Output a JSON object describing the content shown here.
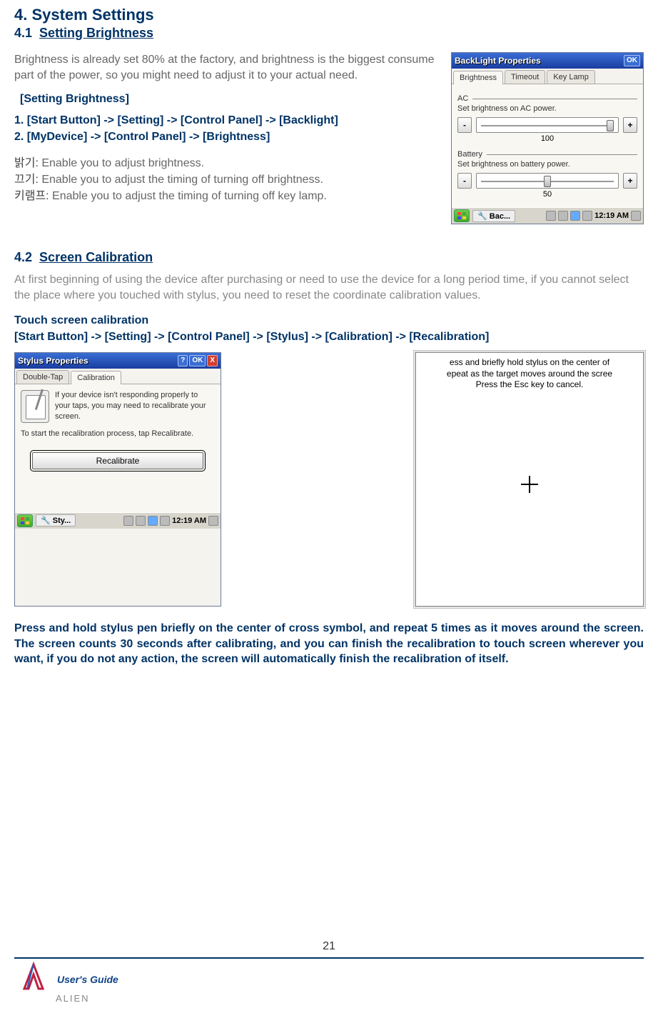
{
  "heading": "4. System Settings",
  "s41": {
    "num": "4.1",
    "title": "Setting Brightness",
    "intro": "Brightness is already set 80% at the factory, and brightness is the biggest consume part of the power, so you might need to adjust it to your actual need.",
    "subhead": "[Setting Brightness]",
    "step1": "1. [Start Button] -> [Setting] -> [Control Panel] -> [Backlight]",
    "step2": "2. [MyDevice] -> [Control Panel] -> [Brightness]",
    "def1_k": "밝기:",
    "def1_v": " Enable you to adjust brightness.",
    "def2_k": "끄기:",
    "def2_v": " Enable you to adjust the timing of turning off brightness.",
    "def3_k": "키램프:",
    "def3_v": " Enable you to adjust the timing of turning off key lamp."
  },
  "dlg_backlight": {
    "title": "BackLight Properties",
    "ok": "OK",
    "tabs": [
      "Brightness",
      "Timeout",
      "Key Lamp"
    ],
    "ac_label": "AC",
    "ac_hint": "Set brightness on AC power.",
    "ac_value": "100",
    "bat_label": "Battery",
    "bat_hint": "Set brightness on battery power.",
    "bat_value": "50",
    "minus": "-",
    "plus": "+",
    "task_app": "Bac...",
    "clock": "12:19 AM"
  },
  "s42": {
    "num": "4.2",
    "title": "Screen Calibration",
    "intro": "At first beginning of using the device after purchasing or need to use the device for a long period time, if you cannot select the place where you touched with stylus, you need to reset the coordinate calibration values.",
    "tsc": "Touch screen calibration",
    "path": "[Start Button] -> [Setting] -> [Control Panel] -> [Stylus] -> [Calibration] -> [Recalibration]"
  },
  "dlg_stylus": {
    "title": "Stylus Properties",
    "help": "?",
    "ok": "OK",
    "close": "X",
    "tabs": [
      "Double-Tap",
      "Calibration"
    ],
    "msg1": "If your device isn't responding properly to your taps, you may need to recalibrate your screen.",
    "msg2": "To start the recalibration process, tap Recalibrate.",
    "btn": "Recalibrate",
    "task_app": "Sty...",
    "clock": "12:19 AM"
  },
  "calib": {
    "line1": "ess and briefly hold stylus on the center of",
    "line2": "epeat as the target moves around the scree",
    "line3": "Press the Esc key to cancel."
  },
  "press_note": "Press and hold stylus pen briefly on the center of cross symbol, and repeat 5 times as it moves around the screen. The screen counts 30 seconds after calibrating, and you can finish the recalibration to touch screen wherever you want, if you do not any action, the screen will automatically finish the recalibration of itself.",
  "footer": {
    "page": "21",
    "guide": "User's Guide",
    "brand": "ALIEN"
  }
}
